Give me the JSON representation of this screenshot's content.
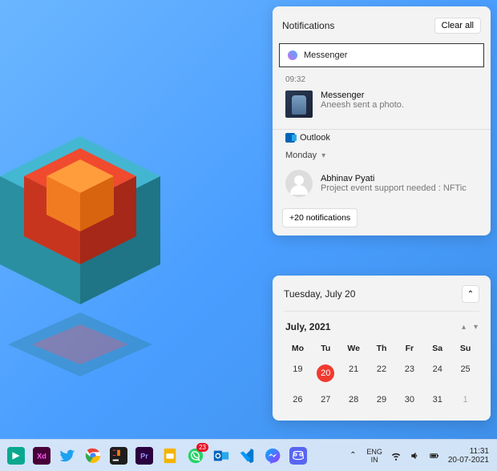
{
  "notifications": {
    "title": "Notifications",
    "clear_all": "Clear all",
    "messenger_group": {
      "icon": "messenger-icon",
      "label": "Messenger"
    },
    "latest": {
      "time": "09:32",
      "app": "Messenger",
      "text": "Aneesh sent a photo."
    },
    "outlook": {
      "label": "Outlook",
      "day": "Monday",
      "sender": "Abhinav Pyati",
      "subject": "Project event support needed : NFTic"
    },
    "more": "+20 notifications"
  },
  "calendar": {
    "full_date": "Tuesday, July 20",
    "month_label": "July, 2021",
    "dow": [
      "Mo",
      "Tu",
      "We",
      "Th",
      "Fr",
      "Sa",
      "Su"
    ],
    "weeks": [
      [
        {
          "n": 19
        },
        {
          "n": 20,
          "today": true
        },
        {
          "n": 21
        },
        {
          "n": 22
        },
        {
          "n": 23
        },
        {
          "n": 24
        },
        {
          "n": 25
        }
      ],
      [
        {
          "n": 26
        },
        {
          "n": 27
        },
        {
          "n": 28
        },
        {
          "n": 29
        },
        {
          "n": 30
        },
        {
          "n": 31
        },
        {
          "n": 1,
          "dim": true
        }
      ]
    ]
  },
  "taskbar": {
    "items": [
      {
        "name": "filmora",
        "color": "#0aa88f"
      },
      {
        "name": "adobe-xd",
        "color": "#470137"
      },
      {
        "name": "twitter",
        "color": "#1da1f2"
      },
      {
        "name": "chrome",
        "color": "#fff"
      },
      {
        "name": "intellij",
        "color": "#1d1d1d"
      },
      {
        "name": "premiere",
        "color": "#2a003f"
      },
      {
        "name": "slides",
        "color": "#f4b400"
      },
      {
        "name": "whatsapp",
        "color": "#25d366",
        "badge": "23"
      },
      {
        "name": "outlook",
        "color": "#0364b8"
      },
      {
        "name": "vscode",
        "color": "#007acc"
      },
      {
        "name": "messenger",
        "color": "#a030ff"
      },
      {
        "name": "discord",
        "color": "#5865f2"
      }
    ],
    "tray": {
      "chevron": "chevron-up-icon",
      "lang_top": "ENG",
      "lang_bottom": "IN",
      "wifi": "wifi-icon",
      "volume": "volume-icon",
      "battery": "battery-icon",
      "time": "11:31",
      "date": "20-07-2021"
    }
  }
}
